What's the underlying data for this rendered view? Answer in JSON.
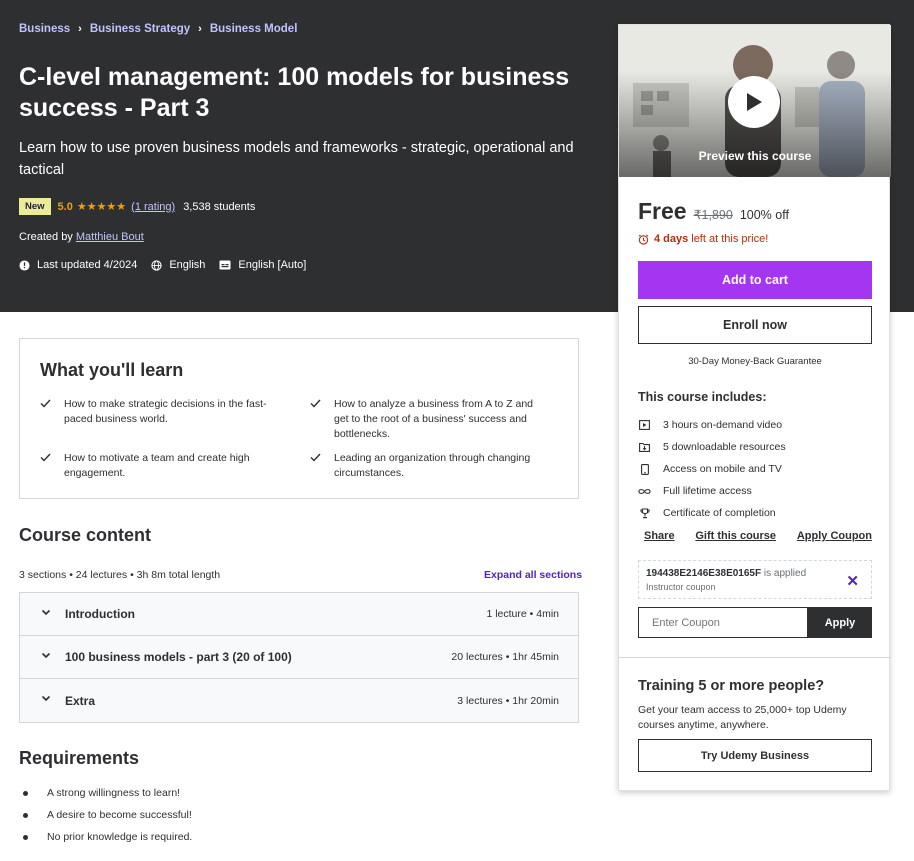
{
  "breadcrumbs": [
    "Business",
    "Business Strategy",
    "Business Model"
  ],
  "course": {
    "title": "C-level management: 100 models for business success - Part 3",
    "subtitle": "Learn how to use proven business models and frameworks - strategic, operational and tactical",
    "badge": "New",
    "rating": "5.0",
    "stars": 5,
    "rating_count": "(1 rating)",
    "students": "3,538 students",
    "created_by_label": "Created by",
    "instructor": "Matthieu Bout",
    "last_updated": "Last updated 4/2024",
    "language": "English",
    "captions": "English [Auto]"
  },
  "sidebar": {
    "preview_label": "Preview this course",
    "price": "Free",
    "original_price": "₹1,890",
    "discount": "100% off",
    "time_left_bold": "4 days",
    "time_left_rest": "left at this price!",
    "add_to_cart": "Add to cart",
    "enroll_now": "Enroll now",
    "guarantee": "30-Day Money-Back Guarantee",
    "includes_title": "This course includes:",
    "includes": [
      {
        "icon": "video-icon",
        "label": "3 hours on-demand video"
      },
      {
        "icon": "download-file-icon",
        "label": "5 downloadable resources"
      },
      {
        "icon": "mobile-icon",
        "label": "Access on mobile and TV"
      },
      {
        "icon": "infinity-icon",
        "label": "Full lifetime access"
      },
      {
        "icon": "trophy-icon",
        "label": "Certificate of completion"
      }
    ],
    "share": "Share",
    "gift": "Gift this course",
    "apply_coupon": "Apply Coupon",
    "coupon_code": "194438E2146E38E0165F",
    "coupon_applied": "is applied",
    "coupon_sub": "Instructor coupon",
    "coupon_placeholder": "Enter Coupon",
    "coupon_apply": "Apply",
    "training_title": "Training 5 or more people?",
    "training_desc": "Get your team access to 25,000+ top Udemy courses anytime, anywhere.",
    "try_business": "Try Udemy Business"
  },
  "learn": {
    "title": "What you'll learn",
    "items": [
      "How to make strategic decisions in the fast-paced business world.",
      "How to analyze a business from A to Z and get to the root of a business' success and bottlenecks.",
      "How to motivate a team and create high engagement.",
      "Leading an organization through changing circumstances."
    ]
  },
  "content": {
    "title": "Course content",
    "meta": "3 sections • 24 lectures • 3h 8m total length",
    "expand_all": "Expand all sections",
    "sections": [
      {
        "name": "Introduction",
        "info": "1 lecture • 4min"
      },
      {
        "name": "100 business models - part 3 (20 of 100)",
        "info": "20 lectures • 1hr 45min"
      },
      {
        "name": "Extra",
        "info": "3 lectures • 1hr 20min"
      }
    ]
  },
  "requirements": {
    "title": "Requirements",
    "items": [
      "A strong willingness to learn!",
      "A desire to become successful!",
      "No prior knowledge is required."
    ]
  }
}
